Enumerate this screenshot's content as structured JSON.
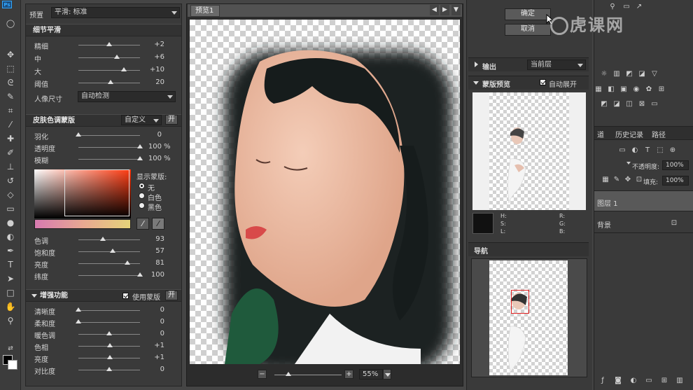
{
  "ps_logo": "Ps",
  "preset": {
    "label": "预置",
    "value": "平滑: 标准"
  },
  "detail_smooth": {
    "title": "细节平滑",
    "sliders": [
      {
        "label": "精细",
        "value": "+2",
        "level": 0.5
      },
      {
        "label": "中",
        "value": "+6",
        "level": 0.62
      },
      {
        "label": "大",
        "value": "+10",
        "level": 0.74
      },
      {
        "label": "阈值",
        "value": "20",
        "level": 0.52
      }
    ],
    "portrait_size": {
      "label": "人像尺寸",
      "value": "自动检测"
    }
  },
  "skin_mask": {
    "title": "皮肤色调蒙版",
    "mode": "自定义",
    "toggle": "开",
    "sliders": [
      {
        "label": "羽化",
        "value": "0",
        "unit": "",
        "level": 0.0
      },
      {
        "label": "透明度",
        "value": "100",
        "unit": "%",
        "level": 1.0
      },
      {
        "label": "模糊",
        "value": "100",
        "unit": "%",
        "level": 1.0
      }
    ],
    "show_mask": {
      "title": "显示蒙版:",
      "options": [
        "无",
        "白色",
        "黑色"
      ],
      "selected": 0
    },
    "color_sliders": [
      {
        "label": "色调",
        "value": "93",
        "level": 0.4
      },
      {
        "label": "饱和度",
        "value": "57",
        "level": 0.56
      },
      {
        "label": "亮度",
        "value": "81",
        "level": 0.8
      },
      {
        "label": "纬度",
        "value": "100",
        "level": 1.0
      }
    ]
  },
  "enhance": {
    "title": "增强功能",
    "use_mask_label": "使用蒙版",
    "toggle": "开",
    "sliders": [
      {
        "label": "清晰度",
        "value": "0",
        "level": 0.0
      },
      {
        "label": "柔和度",
        "value": "0",
        "level": 0.0
      },
      {
        "label": "暖色调",
        "value": "0",
        "level": 0.5
      },
      {
        "label": "色相",
        "value": "+1",
        "level": 0.51
      },
      {
        "label": "亮度",
        "value": "+1",
        "level": 0.51
      },
      {
        "label": "对比度",
        "value": "0",
        "level": 0.5
      }
    ]
  },
  "preview": {
    "tab": "预览1",
    "zoom": "55%"
  },
  "buttons": {
    "ok": "确定",
    "cancel": "取消"
  },
  "output": {
    "label": "输出",
    "value": "当前层"
  },
  "mask_preview": {
    "title": "蒙版预览",
    "auto_expand": "自动展开",
    "readout": {
      "h": "H:",
      "s": "S:",
      "l": "L:",
      "r": "R:",
      "g": "G:",
      "b": "B:"
    }
  },
  "navigator": {
    "title": "导航"
  },
  "ps_panels": {
    "tab_partial": "道",
    "history": "历史记录",
    "paths": "路径",
    "opacity_label": "不透明度:",
    "opacity_value": "100%",
    "fill_label": "填充:",
    "fill_value": "100%",
    "layer1": "图层 1",
    "background": "背景"
  },
  "watermark": "虎课网",
  "colors": {
    "accent": "#31a8ff",
    "panel": "#3a3a3a",
    "nav_box": "#e02020"
  }
}
